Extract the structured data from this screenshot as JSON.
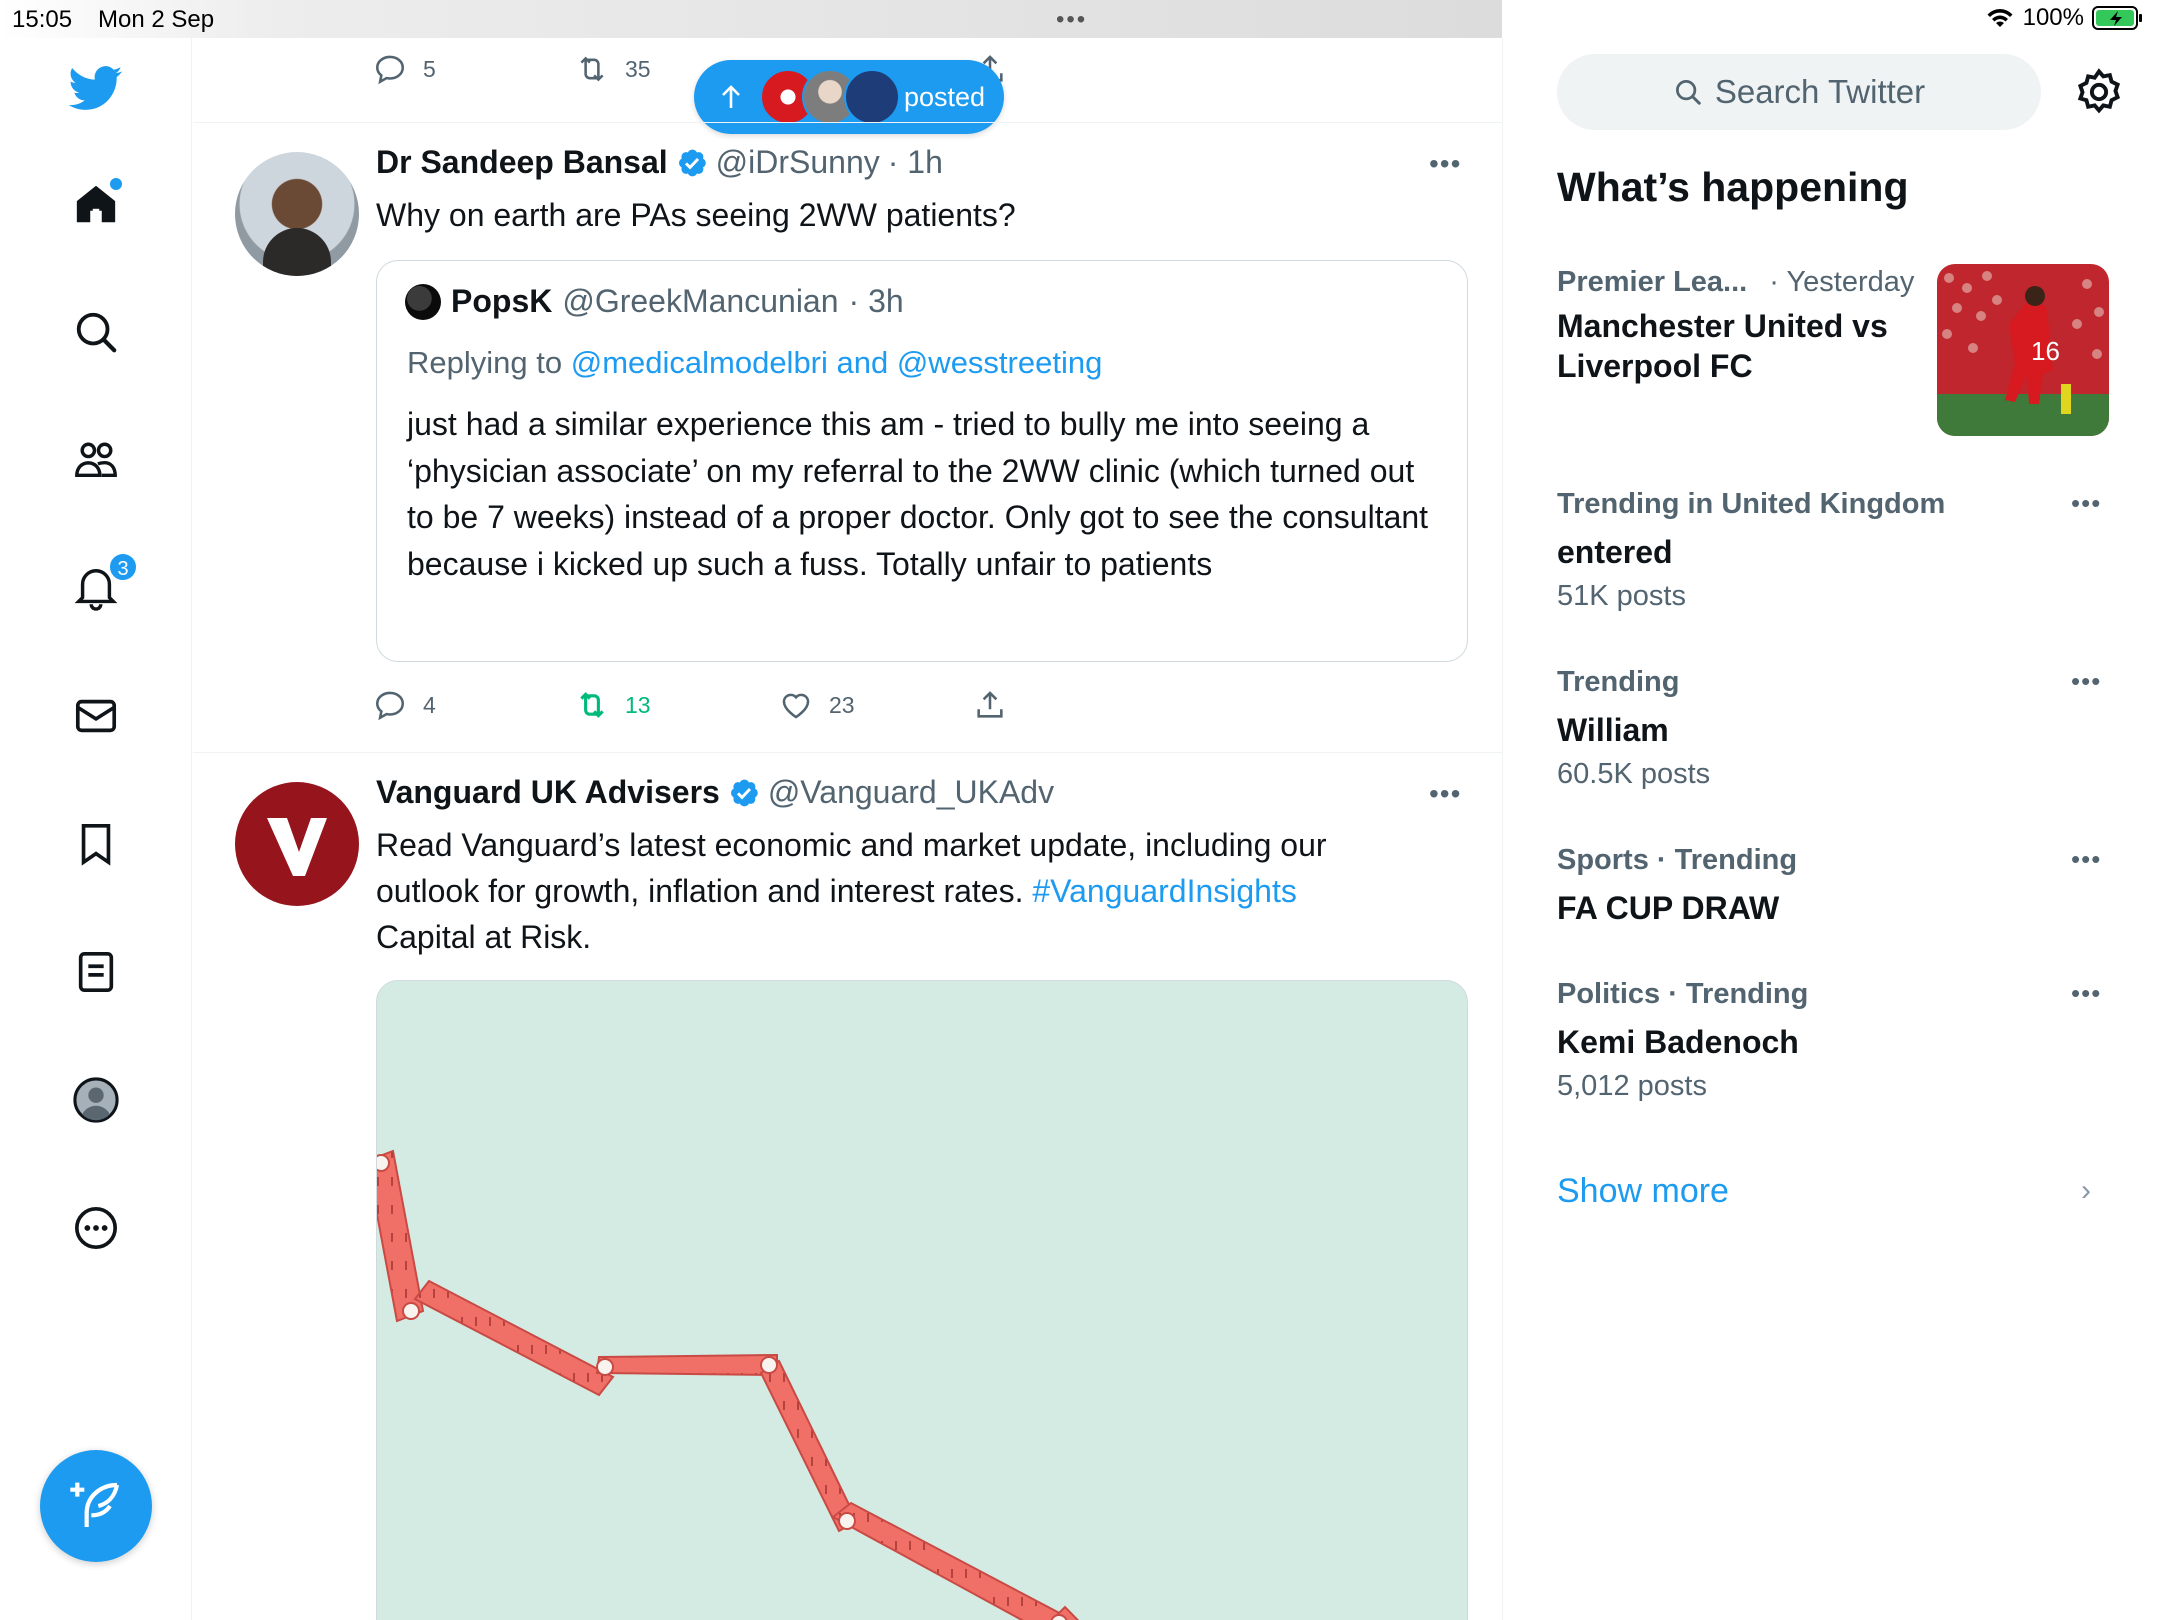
{
  "status_bar": {
    "time": "15:05",
    "date": "Mon 2 Sep",
    "center_dots": "•••",
    "battery": "100%"
  },
  "nav": {
    "notification_count": "3",
    "items": [
      "home-icon",
      "search-icon",
      "communities-icon",
      "notifications-icon",
      "messages-icon",
      "bookmarks-icon",
      "lists-icon",
      "profile-icon",
      "more-icon"
    ]
  },
  "previous_tweet_actions": {
    "replies": "5",
    "retweets": "35"
  },
  "new_posts_pill": {
    "label": "posted"
  },
  "tweet1": {
    "name": "Dr Sandeep Bansal",
    "handle": "@iDrSunny",
    "time": "· 1h",
    "text": "Why on earth are PAs seeing 2WW patients?",
    "quote": {
      "name": "PopsK",
      "handle": "@GreekMancunian",
      "time": "· 3h",
      "replying_prefix": "Replying to",
      "replying_to": "@medicalmodelbri and @wesstreeting",
      "text": "just had a similar experience this am - tried to bully me into seeing a ‘physician associate’ on my referral to the 2WW clinic (which turned out to be 7 weeks) instead of a proper doctor. Only got to see the consultant because i kicked up such a fuss. Totally unfair to patients"
    },
    "replies": "4",
    "retweets": "13",
    "likes": "23"
  },
  "tweet2": {
    "name": "Vanguard UK Advisers",
    "handle": "@Vanguard_UKAdv",
    "text_line1": "Read Vanguard’s latest economic and market update, including our",
    "text_line2": "outlook for growth, inflation and interest rates.",
    "hashtag": "#VanguardInsights",
    "text_line3": "Capital at Risk."
  },
  "sidebar": {
    "search_placeholder": "Search Twitter",
    "whats_happening": "What’s happening",
    "news": {
      "category": "Premier Lea...",
      "time": "· Yesterday",
      "title_line1": "Manchester United vs",
      "title_line2": "Liverpool FC"
    },
    "trends": [
      {
        "meta": "Trending in United Kingdom",
        "title": "entered",
        "count": "51K posts"
      },
      {
        "meta": "Trending",
        "title": "William",
        "count": "60.5K posts"
      },
      {
        "meta": "Sports · Trending",
        "title": "FA CUP DRAW",
        "count": ""
      },
      {
        "meta": "Politics · Trending",
        "title": "Kemi Badenoch",
        "count": "5,012 posts"
      }
    ],
    "show_more": "Show more"
  },
  "colors": {
    "accent": "#1d9bf0",
    "retweet_green": "#00ba7c",
    "secondary_text": "#536471",
    "vanguard_red": "#96151d"
  }
}
